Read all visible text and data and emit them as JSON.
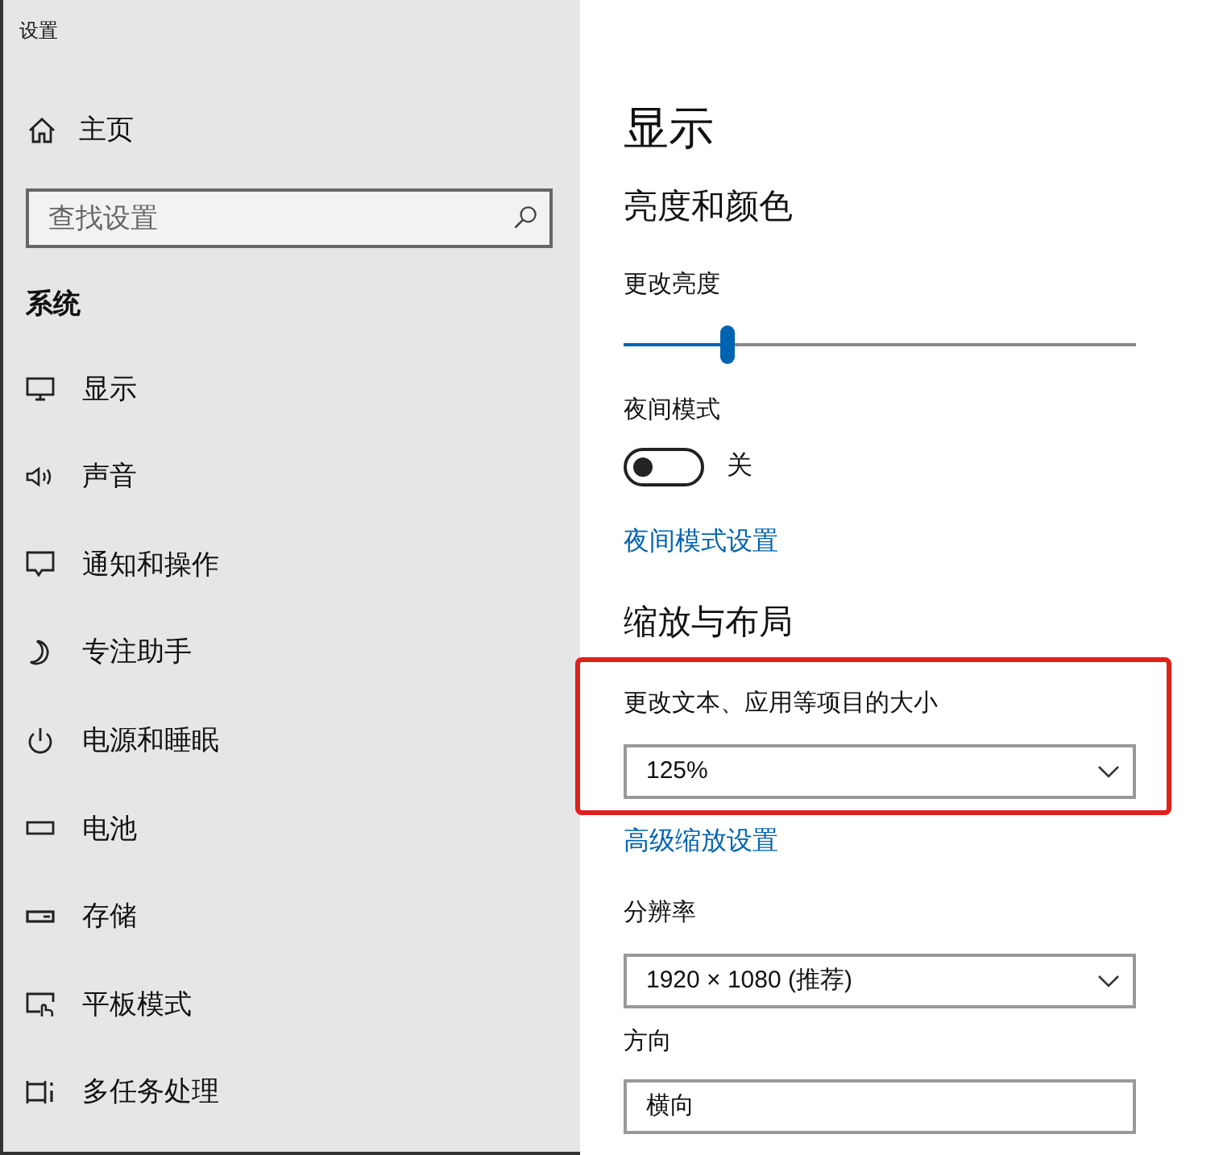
{
  "window": {
    "title": "设置"
  },
  "sidebar": {
    "home": {
      "label": "主页"
    },
    "search": {
      "placeholder": "查找设置"
    },
    "section": "系统",
    "items": [
      {
        "label": "显示"
      },
      {
        "label": "声音"
      },
      {
        "label": "通知和操作"
      },
      {
        "label": "专注助手"
      },
      {
        "label": "电源和睡眠"
      },
      {
        "label": "电池"
      },
      {
        "label": "存储"
      },
      {
        "label": "平板模式"
      },
      {
        "label": "多任务处理"
      }
    ]
  },
  "content": {
    "title": "显示",
    "brightness_section": {
      "heading": "亮度和颜色",
      "brightness": {
        "label": "更改亮度",
        "level": 0.2
      },
      "night_light": {
        "label": "夜间模式",
        "on": false,
        "state_text": "关"
      },
      "link": "夜间模式设置"
    },
    "scale_section": {
      "heading": "缩放与布局",
      "scale": {
        "label": "更改文本、应用等项目的大小",
        "value": "125%",
        "highlighted": true
      },
      "link": "高级缩放设置",
      "resolution": {
        "label": "分辨率",
        "value": "1920 × 1080 (推荐)"
      },
      "orientation": {
        "label": "方向",
        "value": "横向"
      }
    }
  }
}
